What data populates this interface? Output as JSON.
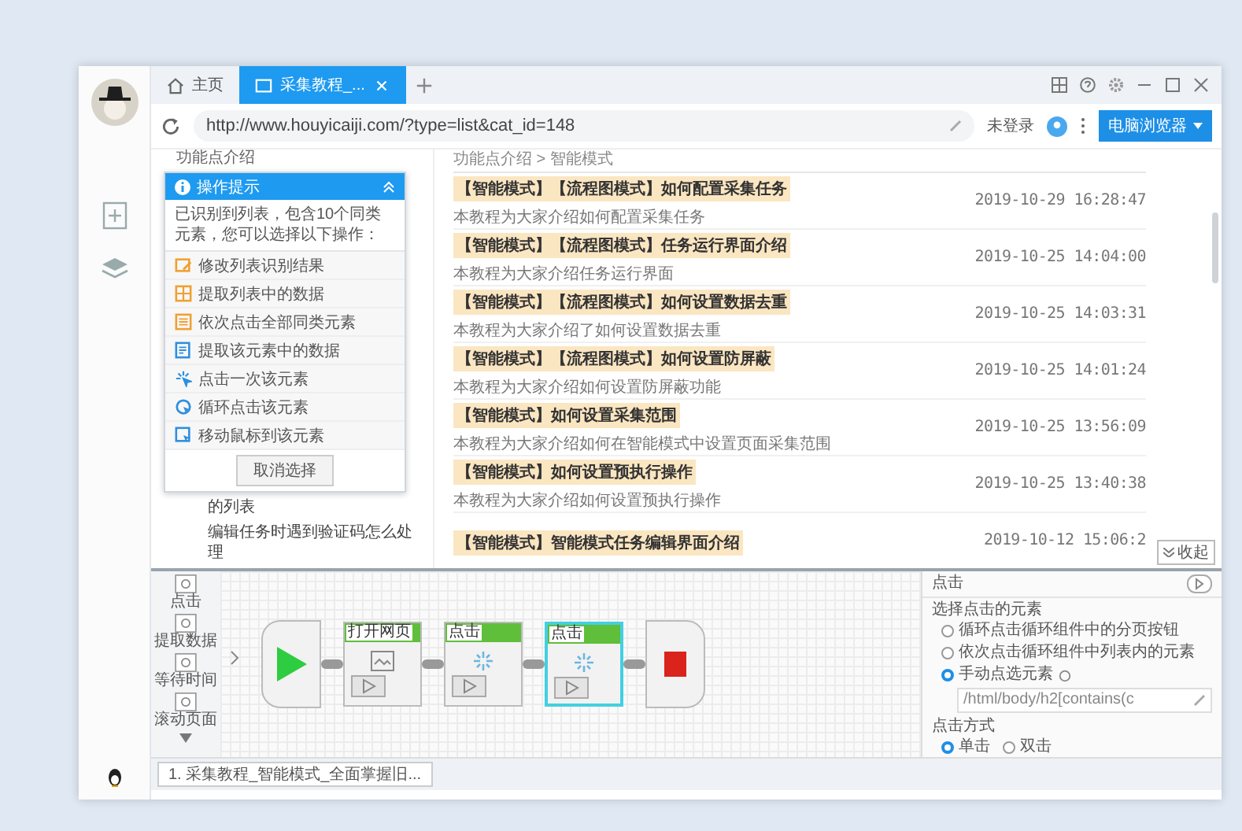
{
  "tabs": [
    {
      "label": "主页",
      "kind": "home",
      "selected": false
    },
    {
      "label": "采集教程_...",
      "kind": "page",
      "selected": true
    }
  ],
  "address_bar": {
    "url": "http://www.houyicaiji.com/?type=list&cat_id=148",
    "login": "未登录",
    "browser_button": "电脑浏览器"
  },
  "sidebar": {
    "section": "功能点介绍",
    "items": [
      "的列表",
      "编辑任务时遇到验证码怎么处理"
    ]
  },
  "popup": {
    "title": "操作提示",
    "message": "已识别到列表，包含10个同类元素，您可以选择以下操作：",
    "actions": [
      {
        "label": "修改列表识别结果",
        "kind": "edit"
      },
      {
        "label": "提取列表中的数据",
        "kind": "grid"
      },
      {
        "label": "依次点击全部同类元素",
        "kind": "list"
      },
      {
        "label": "提取该元素中的数据",
        "kind": "extract"
      },
      {
        "label": "点击一次该元素",
        "kind": "click"
      },
      {
        "label": "循环点击该元素",
        "kind": "loop"
      },
      {
        "label": "移动鼠标到该元素",
        "kind": "move"
      }
    ],
    "cancel": "取消选择"
  },
  "breadcrumb": "功能点介绍 > 智能模式",
  "articles": [
    {
      "title": "【智能模式】【流程图模式】如何配置采集任务",
      "summary": "本教程为大家介绍如何配置采集任务",
      "date": "2019-10-29 16:28:47"
    },
    {
      "title": "【智能模式】【流程图模式】任务运行界面介绍",
      "summary": "本教程为大家介绍任务运行界面",
      "date": "2019-10-25 14:04:00"
    },
    {
      "title": "【智能模式】【流程图模式】如何设置数据去重",
      "summary": "本教程为大家介绍了如何设置数据去重",
      "date": "2019-10-25 14:03:31"
    },
    {
      "title": "【智能模式】【流程图模式】如何设置防屏蔽",
      "summary": "本教程为大家介绍如何设置防屏蔽功能",
      "date": "2019-10-25 14:01:24"
    },
    {
      "title": "【智能模式】如何设置采集范围",
      "summary": "本教程为大家介绍如何在智能模式中设置页面采集范围",
      "date": "2019-10-25 13:56:09"
    },
    {
      "title": "【智能模式】如何设置预执行操作",
      "summary": "本教程为大家介绍如何设置预执行操作",
      "date": "2019-10-25 13:40:38"
    },
    {
      "title": "【智能模式】智能模式任务编辑界面介绍",
      "date": "2019-10-12 15:06:2"
    }
  ],
  "collapse_button": "收起",
  "toolbox": [
    "点击",
    "提取数据",
    "等待时间",
    "滚动页面"
  ],
  "flow": {
    "nodes": [
      {
        "kind": "start"
      },
      {
        "kind": "open_page",
        "label": "打开网页",
        "selected": false
      },
      {
        "kind": "click",
        "label": "点击",
        "selected": false
      },
      {
        "kind": "click",
        "label": "点击",
        "selected": true
      },
      {
        "kind": "end"
      }
    ]
  },
  "properties": {
    "title": "点击",
    "element_label": "选择点击的元素",
    "element_options": [
      {
        "label": "循环点击循环组件中的分页按钮",
        "selected": false
      },
      {
        "label": "依次点击循环组件中列表内的元素",
        "selected": false
      },
      {
        "label": "手动点选元素",
        "selected": true
      }
    ],
    "xpath": "/html/body/h2[contains(c",
    "mode_label": "点击方式",
    "modes": [
      {
        "label": "单击",
        "selected": true
      },
      {
        "label": "双击",
        "selected": false
      }
    ]
  },
  "task_tab": "1. 采集教程_智能模式_全面掌握旧..."
}
